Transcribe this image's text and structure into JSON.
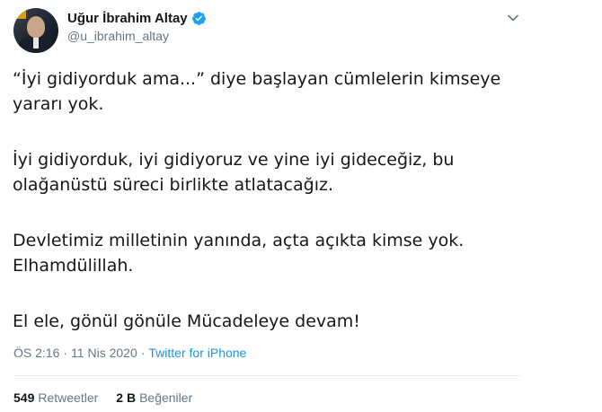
{
  "author": {
    "name": "Uğur İbrahim Altay",
    "handle": "@u_ibrahim_altay",
    "verified": true
  },
  "tweet": {
    "paragraphs": [
      "“İyi gidiyorduk ama...” diye başlayan cümlelerin kimseye yararı yok.",
      "İyi gidiyorduk, iyi gidiyoruz ve yine iyi gideceğiz, bu olağanüstü süreci birlikte atlatacağız.",
      "Devletimiz milletinin yanında, açta açıkta kimse yok. Elhamdülillah.",
      "El ele, gönül gönüle Mücadeleye devam!"
    ]
  },
  "meta": {
    "time": "ÖS 2:16",
    "separator": "·",
    "date": "11 Nis 2020",
    "source": "Twitter for iPhone"
  },
  "stats": {
    "retweets_count": "549",
    "retweets_label": "Retweetler",
    "likes_count": "2 B",
    "likes_label": "Beğeniler"
  },
  "colors": {
    "verified": "#1da1f2",
    "link": "#1b95e0",
    "muted": "#657786",
    "text": "#14171a",
    "divider": "#e6ecf0"
  },
  "icons": {
    "verified": "verified-badge-icon",
    "menu": "chevron-down-icon"
  }
}
